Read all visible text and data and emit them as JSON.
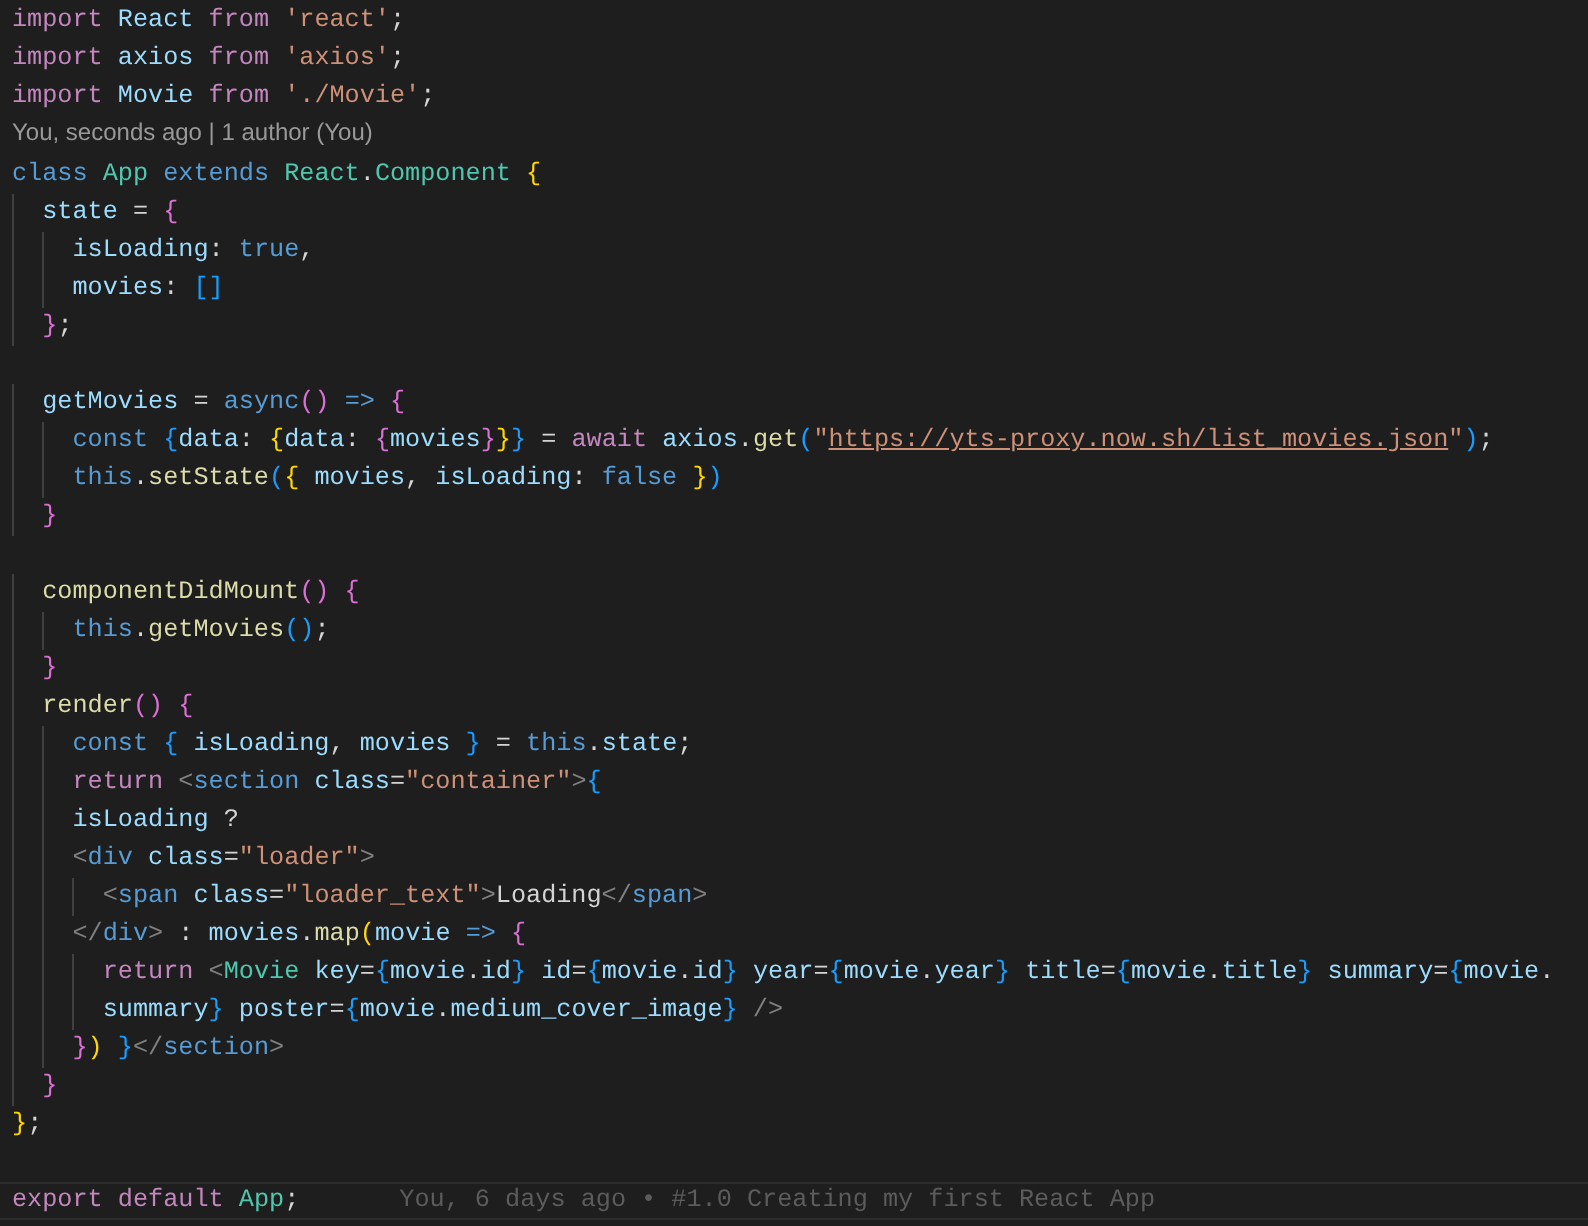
{
  "editor": {
    "lines": [
      {
        "kind": "code",
        "current": false,
        "text": "import React from 'react';"
      },
      {
        "kind": "code",
        "current": false,
        "text": "import axios from 'axios';"
      },
      {
        "kind": "code",
        "current": false,
        "text": "import Movie from './Movie';"
      },
      {
        "kind": "codelens",
        "current": false,
        "text": "You, seconds ago | 1 author (You)"
      },
      {
        "kind": "code",
        "current": false,
        "text": "class App extends React.Component {"
      },
      {
        "kind": "code",
        "current": false,
        "text": "  state = {"
      },
      {
        "kind": "code",
        "current": false,
        "text": "    isLoading: true,"
      },
      {
        "kind": "code",
        "current": false,
        "text": "    movies: []"
      },
      {
        "kind": "code",
        "current": false,
        "text": "  };"
      },
      {
        "kind": "blank",
        "current": false
      },
      {
        "kind": "code",
        "current": false,
        "text": "  getMovies = async() => {"
      },
      {
        "kind": "code",
        "current": false,
        "text": "    const {data: {data: {movies}}} = await axios.get(\"https://yts-proxy.now.sh/list_movies.json\");"
      },
      {
        "kind": "code",
        "current": false,
        "text": "    this.setState({ movies, isLoading: false })"
      },
      {
        "kind": "code",
        "current": false,
        "text": "  }"
      },
      {
        "kind": "blank",
        "current": false
      },
      {
        "kind": "code",
        "current": false,
        "text": "  componentDidMount() {"
      },
      {
        "kind": "code",
        "current": false,
        "text": "    this.getMovies();"
      },
      {
        "kind": "code",
        "current": false,
        "text": "  }"
      },
      {
        "kind": "code",
        "current": false,
        "text": "  render() {"
      },
      {
        "kind": "code",
        "current": false,
        "text": "    const { isLoading, movies } = this.state;"
      },
      {
        "kind": "code",
        "current": false,
        "text": "    return <section class=\"container\">{"
      },
      {
        "kind": "code",
        "current": false,
        "text": "    isLoading ?"
      },
      {
        "kind": "code",
        "current": false,
        "text": "    <div class=\"loader\">"
      },
      {
        "kind": "code",
        "current": false,
        "text": "      <span class=\"loader_text\">Loading</span>"
      },
      {
        "kind": "code",
        "current": false,
        "text": "    </div> : movies.map(movie => {"
      },
      {
        "kind": "code",
        "current": false,
        "text": "      return <Movie key={movie.id} id={movie.id} year={movie.year} title={movie.title} summary={movie."
      },
      {
        "kind": "code",
        "current": false,
        "text": "      summary} poster={movie.medium_cover_image} />"
      },
      {
        "kind": "code",
        "current": false,
        "text": "    }) }</section>"
      },
      {
        "kind": "code",
        "current": false,
        "text": "  }"
      },
      {
        "kind": "code",
        "current": false,
        "text": "};"
      },
      {
        "kind": "blank",
        "current": false
      },
      {
        "kind": "code",
        "current": true,
        "text": "export default App;",
        "blame": "You, 6 days ago • #1.0 Creating my first React App"
      }
    ]
  }
}
